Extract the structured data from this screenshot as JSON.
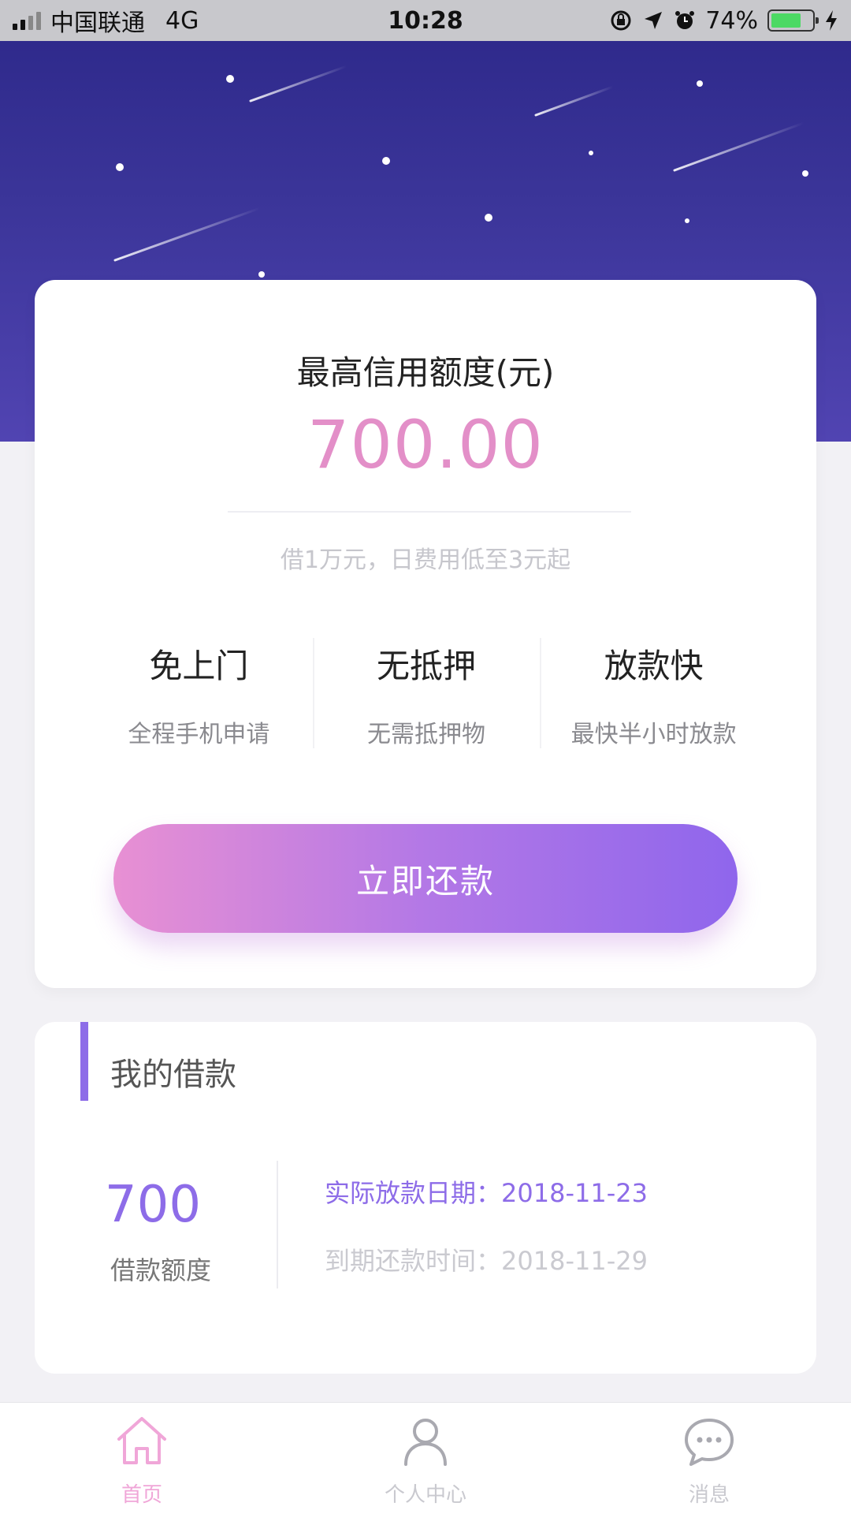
{
  "status_bar": {
    "carrier": "中国联通",
    "network": "4G",
    "time": "10:28",
    "battery": "74%",
    "battery_level": 0.74
  },
  "credit": {
    "title": "最高信用额度(元)",
    "amount": "700.00",
    "note": "借1万元，日费用低至3元起"
  },
  "features": [
    {
      "title": "免上门",
      "desc": "全程手机申请"
    },
    {
      "title": "无抵押",
      "desc": "无需抵押物"
    },
    {
      "title": "放款快",
      "desc": "最快半小时放款"
    }
  ],
  "repay_button": {
    "label": "立即还款"
  },
  "loan": {
    "title": "我的借款",
    "amount": "700",
    "amount_label": "借款额度",
    "release_date": "实际放款日期：2018-11-23",
    "due_date": "到期还款时间：2018-11-29"
  },
  "tabs": [
    {
      "label": "首页",
      "icon": "home-icon",
      "active": true
    },
    {
      "label": "个人中心",
      "icon": "user-icon",
      "active": false
    },
    {
      "label": "消息",
      "icon": "message-icon",
      "active": false
    }
  ],
  "colors": {
    "accent_pink": "#e38fc8",
    "accent_purple": "#8d6ce8",
    "hero_dark": "#2f2a8c",
    "battery_green": "#4cd964"
  }
}
